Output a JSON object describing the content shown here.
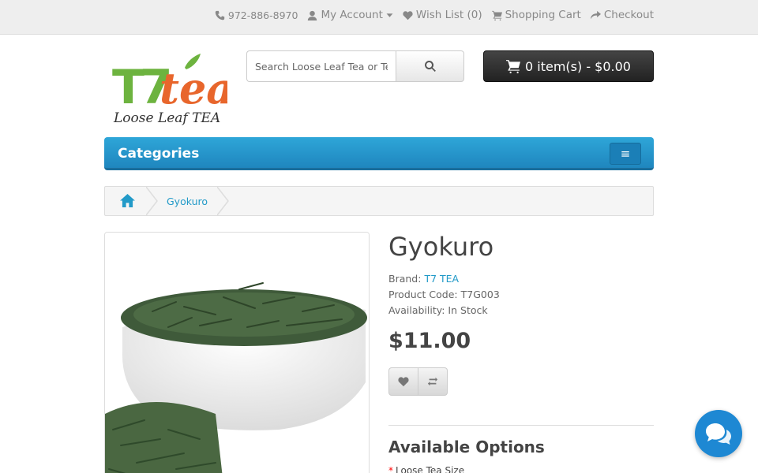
{
  "topbar": {
    "phone": "972-886-8970",
    "account": "My Account",
    "wishlist": "Wish List (0)",
    "cart": "Shopping Cart",
    "checkout": "Checkout"
  },
  "logo": {
    "brand": "T7tea",
    "tagline": "Loose Leaf TEA"
  },
  "search": {
    "placeholder": "Search Loose Leaf Tea or Tea"
  },
  "cart": {
    "label": "0 item(s) - $0.00"
  },
  "categories": {
    "label": "Categories",
    "toggle": "≡"
  },
  "breadcrumb": {
    "items": [
      "Gyokuro"
    ]
  },
  "product": {
    "title": "Gyokuro",
    "brand_label": "Brand:",
    "brand": "T7 TEA",
    "code_label": "Product Code:",
    "code": "T7G003",
    "availability_label": "Availability:",
    "availability": "In Stock",
    "price": "$11.00"
  },
  "options": {
    "title": "Available Options",
    "first_label": "Loose Tea Size",
    "required_mark": "*"
  },
  "colors": {
    "accent": "#229ac8",
    "bar": "#2ea6d8",
    "cart": "#333333",
    "chat": "#1e88d3",
    "logo_green": "#6db33f",
    "logo_orange": "#e8662c"
  }
}
